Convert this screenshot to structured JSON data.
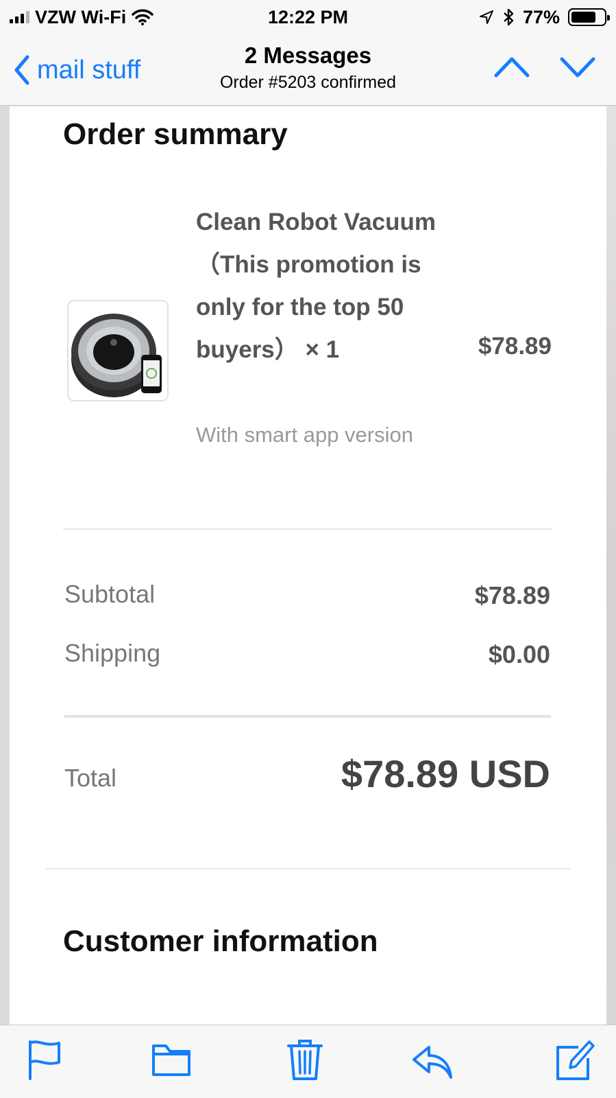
{
  "status_bar": {
    "carrier": "VZW Wi-Fi",
    "time": "12:22 PM",
    "battery_percent": "77%",
    "battery_level": 0.77,
    "icons": [
      "signal-icon",
      "wifi-icon",
      "location-arrow-icon",
      "bluetooth-icon",
      "battery-icon"
    ]
  },
  "nav": {
    "back_label": "mail stuff",
    "title": "2 Messages",
    "subtitle": "Order #5203 confirmed",
    "icons": [
      "chevron-left-icon",
      "chevron-up-icon",
      "chevron-down-icon"
    ]
  },
  "email": {
    "order_summary_heading": "Order summary",
    "product": {
      "name": "Clean Robot Vacuum（This promotion is only for the top 50 buyers） × 1",
      "variant": "With smart app version",
      "price": "$78.89"
    },
    "subtotal_label": "Subtotal",
    "subtotal_value": "$78.89",
    "shipping_label": "Shipping",
    "shipping_value": "$0.00",
    "total_label": "Total",
    "total_value": "$78.89 USD",
    "customer_heading": "Customer information"
  },
  "toolbar": {
    "icons": [
      "flag-icon",
      "folder-icon",
      "trash-icon",
      "reply-icon",
      "compose-icon"
    ]
  },
  "colors": {
    "accent": "#157efb",
    "bar_background": "#f7f7f7",
    "text_gray": "#555555",
    "label_gray": "#777777",
    "variant_gray": "#999999"
  }
}
